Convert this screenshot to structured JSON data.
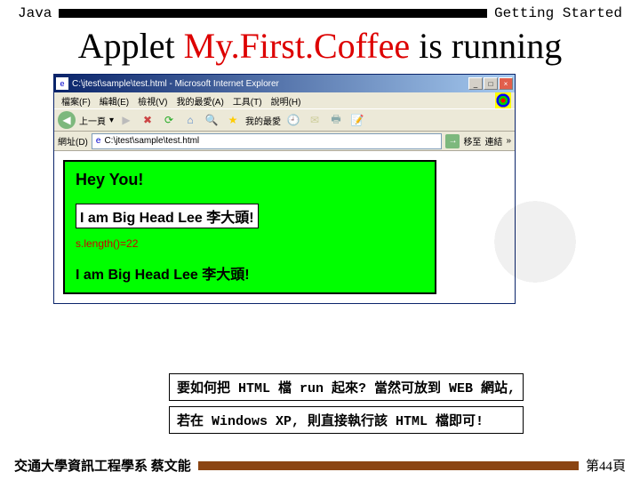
{
  "header": {
    "left": "Java",
    "right": "Getting Started"
  },
  "title": {
    "pre": "Applet ",
    "highlight": "My.First.Coffee",
    "post": " is running"
  },
  "browser": {
    "title": "C:\\jtest\\sample\\test.html - Microsoft Internet Explorer",
    "menus": {
      "file": "檔案(F)",
      "edit": "編輯(E)",
      "view": "檢視(V)",
      "fav": "我的最愛(A)",
      "tools": "工具(T)",
      "help": "說明(H)"
    },
    "toolbar": {
      "back": "上一頁",
      "fav": "我的最愛"
    },
    "address": {
      "label": "網址(D)",
      "value": "C:\\jtest\\sample\\test.html",
      "go": "移至",
      "links": "連結"
    }
  },
  "applet": {
    "hey": "Hey You!",
    "boxed": "I am Big Head Lee 李大頭!",
    "slength": "s.length()=22",
    "plain": "I am Big Head Lee 李大頭!"
  },
  "notes": {
    "line1": "要如何把 HTML 檔 run 起來? 當然可放到 WEB 網站,",
    "line2": "若在 Windows XP, 則直接執行該 HTML 檔即可!"
  },
  "footer": {
    "left": "交通大學資訊工程學系 蔡文能",
    "page": "第44頁"
  }
}
